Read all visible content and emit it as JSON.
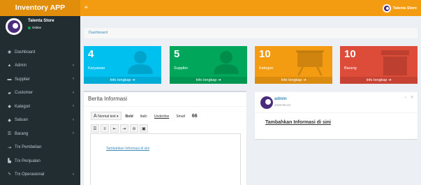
{
  "app": {
    "name": "Inventory APP"
  },
  "header": {
    "menu_icon": "hamburger-icon",
    "user_label": "Talenta Store"
  },
  "sidebar": {
    "user": {
      "name": "Talenta Store",
      "status": "Online",
      "status_color": "#00a65a"
    },
    "items": [
      {
        "label": "Dashboard",
        "icon": "dashboard-icon",
        "glyph": "◉",
        "has_chevron": false
      },
      {
        "label": "Admin",
        "icon": "user-icon",
        "glyph": "👤",
        "has_chevron": true
      },
      {
        "label": "Supplier",
        "icon": "truck-icon",
        "glyph": "▬",
        "has_chevron": true
      },
      {
        "label": "Customer",
        "icon": "customer-icon",
        "glyph": "▰",
        "has_chevron": true
      },
      {
        "label": "Kategori",
        "icon": "tag-icon",
        "glyph": "◆",
        "has_chevron": true
      },
      {
        "label": "Satuan",
        "icon": "unit-icon",
        "glyph": "◆",
        "has_chevron": true
      },
      {
        "label": "Barang",
        "icon": "list-icon",
        "glyph": "☰",
        "has_chevron": true
      },
      {
        "label": "Trx Pembelian",
        "icon": "sign-in-icon",
        "glyph": "⇥",
        "has_chevron": false
      },
      {
        "label": "Trx Penjualan",
        "icon": "cart-icon",
        "glyph": "▙",
        "has_chevron": false
      },
      {
        "label": "Trx Operasional",
        "icon": "bolt-icon",
        "glyph": "⚡",
        "has_chevron": true
      }
    ]
  },
  "breadcrumb": {
    "label": "Dashboard"
  },
  "stats": [
    {
      "value": "4",
      "label": "Karyawan",
      "link": "Info lengkap",
      "color": "#00c0ef",
      "icon": "person-icon"
    },
    {
      "value": "5",
      "label": "Supplier",
      "link": "Info lengkap",
      "color": "#00a65a",
      "icon": "person-icon"
    },
    {
      "value": "10",
      "label": "Kategori",
      "link": "Info lengkap",
      "color": "#f39c12",
      "icon": "easel-icon"
    },
    {
      "value": "10",
      "label": "Barang",
      "link": "Info lengkap",
      "color": "#dd4b39",
      "icon": "box-icon"
    }
  ],
  "berita": {
    "title": "Berita Informasi",
    "toolbar": {
      "style_dropdown": "Normal text",
      "bold": "Bold",
      "italic": "Italic",
      "underline": "Underline",
      "small": "Small",
      "quote": "66"
    },
    "editor_link": "Tambahkan Informasi di sini"
  },
  "post": {
    "user": "admin",
    "date": "2020-05-23",
    "body": "Tambahkan Informasi di sini"
  }
}
